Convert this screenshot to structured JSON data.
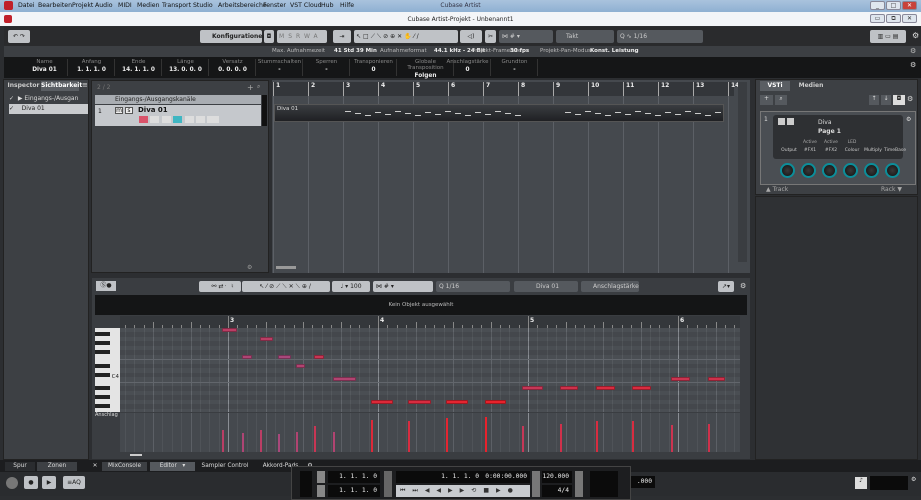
{
  "window": {
    "app_title": "Cubase Artist",
    "project_title": "Cubase Artist-Projekt - Unbenannt1"
  },
  "menu": [
    "Datei",
    "Bearbeiten",
    "Projekt",
    "Audio",
    "MIDI",
    "Medien",
    "Transport",
    "Studio",
    "Arbeitsbereiche",
    "Fenster",
    "VST Cloud",
    "Hub",
    "Hilfe"
  ],
  "toolbar": {
    "config_label": "Konfigurationen",
    "msrwa": [
      "M",
      "S",
      "R",
      "W",
      "A"
    ],
    "grid_type": "Takt",
    "quantize": "1/16"
  },
  "status": {
    "items": [
      {
        "label": "Max. Aufnahmezeit",
        "value": "41 Std 39 Min"
      },
      {
        "label": "Aufnahmeformat",
        "value": "44.1 kHz - 24 Bit"
      },
      {
        "label": "Projekt-Framerate",
        "value": "30 fps"
      },
      {
        "label": "Projekt-Pan-Modus",
        "value": "Konst. Leistung"
      }
    ]
  },
  "infoline": [
    {
      "label": "Name",
      "value": "Diva 01"
    },
    {
      "label": "Anfang",
      "value": "1. 1. 1.   0"
    },
    {
      "label": "Ende",
      "value": "14. 1. 1.   0"
    },
    {
      "label": "Länge",
      "value": "13. 0. 0.   0"
    },
    {
      "label": "Versatz",
      "value": "0. 0. 0.   0"
    },
    {
      "label": "Stummschalten",
      "value": "-"
    },
    {
      "label": "Sperren",
      "value": "-"
    },
    {
      "label": "Transponieren",
      "value": "0"
    },
    {
      "label": "Globale Transposition",
      "value": "Folgen"
    },
    {
      "label": "Anschlagstärke",
      "value": "0"
    },
    {
      "label": "Grundton",
      "value": "-"
    }
  ],
  "inspector": {
    "tabs": [
      "Inspector",
      "Sichtbarkeit"
    ],
    "items": [
      "Eingangs-/Ausgan",
      "Diva 01"
    ]
  },
  "tracklist": {
    "count": "2 / 2",
    "folder": "Eingangs-/Ausgangskanäle",
    "track_number": "1",
    "track_name": "Diva 01",
    "buttons": [
      "m",
      "s"
    ]
  },
  "arrange": {
    "bars": [
      "1",
      "2",
      "3",
      "4",
      "5",
      "6",
      "7",
      "8",
      "9",
      "10",
      "11",
      "12",
      "13",
      "14"
    ],
    "part_name": "Diva 01"
  },
  "vsti": {
    "tabs": [
      "VSTi",
      "Medien"
    ],
    "slot": "1",
    "instrument": "Diva",
    "page": "Page 1",
    "param_top": [
      "Active",
      "Active",
      "LED"
    ],
    "params": [
      "Output",
      "#FX1",
      "#FX2",
      "Colour",
      "Multiply",
      "TimeBase"
    ],
    "track_label": "▲ Track",
    "rack_label": "Rack ▼"
  },
  "key_editor": {
    "velocity_value": "100",
    "quantize": "1/16",
    "part": "Diva 01",
    "lane_param": "Anschlagstärke",
    "info": "Kein Objekt ausgewählt",
    "bars": [
      "3",
      "4",
      "5",
      "6"
    ],
    "key_label": "C4",
    "lane_label": "Anschlag",
    "colors": {
      "low": "#a8497c",
      "high": "#e8222c"
    },
    "notes": [
      {
        "pitch": "B4",
        "start": 2.96,
        "length": 0.1,
        "velocity": 77
      },
      {
        "pitch": "F4",
        "start": 3.09,
        "length": 0.07,
        "velocity": 66
      },
      {
        "pitch": "A4",
        "start": 3.21,
        "length": 0.09,
        "velocity": 77
      },
      {
        "pitch": "F4",
        "start": 3.33,
        "length": 0.09,
        "velocity": 61
      },
      {
        "pitch": "D#4",
        "start": 3.45,
        "length": 0.06,
        "velocity": 68
      },
      {
        "pitch": "F4",
        "start": 3.57,
        "length": 0.07,
        "velocity": 90
      },
      {
        "pitch": "C4",
        "start": 3.7,
        "length": 0.15,
        "velocity": 68
      },
      {
        "pitch": "G3",
        "start": 3.95,
        "length": 0.15,
        "velocity": 110
      },
      {
        "pitch": "G3",
        "start": 4.2,
        "length": 0.15,
        "velocity": 105
      },
      {
        "pitch": "G3",
        "start": 4.45,
        "length": 0.15,
        "velocity": 116
      },
      {
        "pitch": "G3",
        "start": 4.71,
        "length": 0.14,
        "velocity": 121
      },
      {
        "pitch": "A#3",
        "start": 4.96,
        "length": 0.14,
        "velocity": 88
      },
      {
        "pitch": "A#3",
        "start": 5.21,
        "length": 0.12,
        "velocity": 97
      },
      {
        "pitch": "A#3",
        "start": 5.45,
        "length": 0.13,
        "velocity": 105
      },
      {
        "pitch": "A#3",
        "start": 5.69,
        "length": 0.13,
        "velocity": 105
      },
      {
        "pitch": "C4",
        "start": 5.95,
        "length": 0.13,
        "velocity": 93
      },
      {
        "pitch": "C4",
        "start": 6.2,
        "length": 0.11,
        "velocity": 97
      }
    ]
  },
  "bottom_tabs": [
    "Spur",
    "Zonen",
    "MixConsole",
    "Editor",
    "Sampler Control",
    "Akkord-Pads"
  ],
  "transport": {
    "left_locator": "1. 1. 1.   0",
    "right_locator": "1. 1. 1.   0",
    "position_bars": "1. 1. 1.   0",
    "position_time": "0:00:00.000",
    "tempo": "120.000",
    "signature": "4/4",
    "secondary": ".000",
    "aq": "AQ"
  }
}
